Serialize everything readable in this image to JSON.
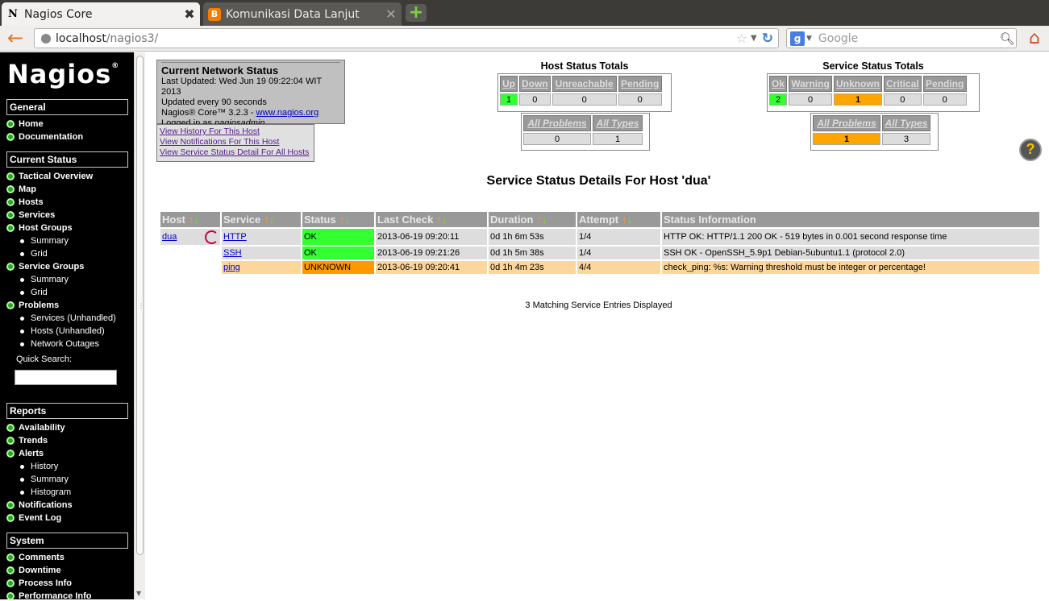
{
  "browser": {
    "tabs": [
      {
        "favicon": "N",
        "title": "Nagios Core",
        "close": "✖"
      },
      {
        "favicon": "B",
        "title": "Komunikasi Data Lanjut",
        "close": "✕"
      }
    ],
    "newtab": "+",
    "url_host": "localhost",
    "url_path": "/nagios3/",
    "search_engine": "g",
    "search_placeholder": "Google"
  },
  "sidebar": {
    "logo": "Nagios",
    "logo_mark": "®",
    "sections": [
      {
        "title": "General"
      },
      {
        "title": "Current Status"
      },
      {
        "title": "Reports"
      },
      {
        "title": "System"
      }
    ],
    "general": [
      "Home",
      "Documentation"
    ],
    "current_status": {
      "tactical": "Tactical Overview",
      "map": "Map",
      "hosts": "Hosts",
      "services": "Services",
      "host_groups": "Host Groups",
      "hg_summary": "Summary",
      "hg_grid": "Grid",
      "service_groups": "Service Groups",
      "sg_summary": "Summary",
      "sg_grid": "Grid",
      "problems": "Problems",
      "pr_services": "Services (Unhandled)",
      "pr_hosts": "Hosts (Unhandled)",
      "pr_outages": "Network Outages",
      "quick_search": "Quick Search:"
    },
    "reports": {
      "availability": "Availability",
      "trends": "Trends",
      "alerts": "Alerts",
      "al_history": "History",
      "al_summary": "Summary",
      "al_histogram": "Histogram",
      "notifications": "Notifications",
      "event_log": "Event Log"
    },
    "system": {
      "comments": "Comments",
      "downtime": "Downtime",
      "process_info": "Process Info",
      "performance_info": "Performance Info"
    }
  },
  "info": {
    "title": "Current Network Status",
    "last_updated": "Last Updated: Wed Jun 19 09:22:04 WIT 2013",
    "updated_every": "Updated every 90 seconds",
    "core_prefix": "Nagios® Core™ 3.2.3 - ",
    "core_link": "www.nagios.org",
    "logged_prefix": "Logged in as ",
    "logged_user": "nagiosadmin",
    "links": [
      "View History For This Host",
      "View Notifications For This Host",
      "View Service Status Detail For All Hosts"
    ]
  },
  "host_totals": {
    "title": "Host Status Totals",
    "headers": [
      "Up",
      "Down",
      "Unreachable",
      "Pending"
    ],
    "values": [
      "1",
      "0",
      "0",
      "0"
    ],
    "sum_headers": [
      "All Problems",
      "All Types"
    ],
    "sum_values": [
      "0",
      "1"
    ]
  },
  "service_totals": {
    "title": "Service Status Totals",
    "headers": [
      "Ok",
      "Warning",
      "Unknown",
      "Critical",
      "Pending"
    ],
    "values": [
      "2",
      "0",
      "1",
      "0",
      "0"
    ],
    "sum_headers": [
      "All Problems",
      "All Types"
    ],
    "sum_values": [
      "1",
      "3"
    ]
  },
  "help_icon": "?",
  "details": {
    "title": "Service Status Details For Host 'dua'",
    "columns": [
      "Host",
      "Service",
      "Status",
      "Last Check",
      "Duration",
      "Attempt",
      "Status Information"
    ],
    "sort_up": "↑",
    "sort_down": "↓",
    "rows": [
      {
        "host": "dua",
        "service": "HTTP",
        "status": "OK",
        "last_check": "2013-06-19 09:20:11",
        "duration": "0d 1h 6m 53s",
        "attempt": "1/4",
        "info": "HTTP OK: HTTP/1.1 200 OK - 519 bytes in 0.001 second response time"
      },
      {
        "host": "",
        "service": "SSH",
        "status": "OK",
        "last_check": "2013-06-19 09:21:26",
        "duration": "0d 1h 5m 38s",
        "attempt": "1/4",
        "info": "SSH OK - OpenSSH_5.9p1 Debian-5ubuntu1.1 (protocol 2.0)"
      },
      {
        "host": "",
        "service": "ping",
        "status": "UNKNOWN",
        "last_check": "2013-06-19 09:20:41",
        "duration": "0d 1h 4m 23s",
        "attempt": "4/4",
        "info": "check_ping: %s: Warning threshold must be integer or percentage!"
      }
    ],
    "footer": "3 Matching Service Entries Displayed"
  },
  "colors": {
    "ok": "#33ff33",
    "unknown": "#ff9900",
    "accent": "#ffa500"
  }
}
